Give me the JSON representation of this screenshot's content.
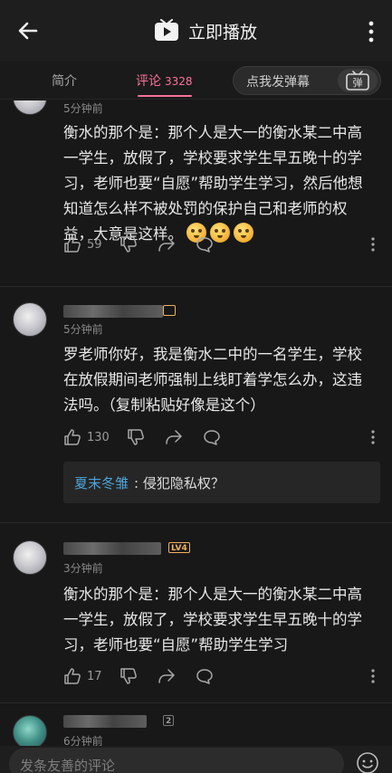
{
  "header": {
    "title": "立即播放"
  },
  "tabs": {
    "intro": "简介",
    "comments": "评论",
    "comments_count": "3328",
    "danmaku_placeholder": "点我发弹幕",
    "danmaku_icon_text": "弹"
  },
  "comments": [
    {
      "time": "5分钟前",
      "text": "衡水的那个是：那个人是大一的衡水某二中高一学生，放假了，学校要求学生早五晚十的学习，老师也要“自愿”帮助学生学习，然后他想知道怎么样不被处罚的保护自己和老师的权益，大意是这样。",
      "likes": "59"
    },
    {
      "time": "5分钟前",
      "text": "罗老师你好，我是衡水二中的一名学生，学校在放假期间老师强制上线盯着学怎么办，这违法吗。（复制粘贴好像是这个）",
      "likes": "130",
      "reply": {
        "name": "夏末冬雏",
        "text": ": 侵犯隐私权？"
      }
    },
    {
      "time": "3分钟前",
      "level": "LV4",
      "text": "衡水的那个是：那个人是大一的衡水某二中高一学生，放假了，学校要求学生早五晚十的学习，老师也要“自愿”帮助学生学习",
      "likes": "17"
    },
    {
      "time": "6分钟前",
      "badge": "2"
    }
  ],
  "bottom": {
    "placeholder": "发条友善的评论"
  },
  "colors": {
    "accent": "#fb7299",
    "background": "#181818",
    "reply_name": "#4aa3d8"
  }
}
